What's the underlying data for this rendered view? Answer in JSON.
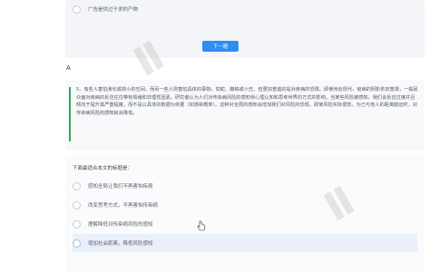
{
  "top": {
    "prev_option_text": "广告是供过于求的产物"
  },
  "next_button": {
    "label": "下一题"
  },
  "section_letter": "A",
  "question": {
    "text": "5、有些人害怕演化或获小的空间，而另一些人则害怕具体的事物，如蛇、蜘蛛或小丑，但更加普遍的是对疾病的恐惧。即使身处现代，疫病的阴影依旧笼罩，一般民众面对疾病的反应往往带有情绪和非理性因素。研究者认为人们对传染病风险的感知受心理认知和思考世界的方式的影响。当某些风险被感知，我们会反应过度并且倾向于提升其严重程度，而不是以具体的数据为依据（如感染概率）。这种对全局的感知会增加我们对风险的恐惧，即使风险实际很低，为己与他人的距离越远时，对传染病风险的感知就会降低。"
  },
  "prompt": "下面最适合本文的标题是：",
  "options": [
    {
      "text": "感知全局让我们不再害怕疾病",
      "selected": false
    },
    {
      "text": "改变思考方式，不再害怕传染病",
      "selected": false
    },
    {
      "text": "理解降低对传染病风险的感知",
      "selected": false
    },
    {
      "text": "增加社会距离，降低风险感知",
      "selected": true
    }
  ]
}
